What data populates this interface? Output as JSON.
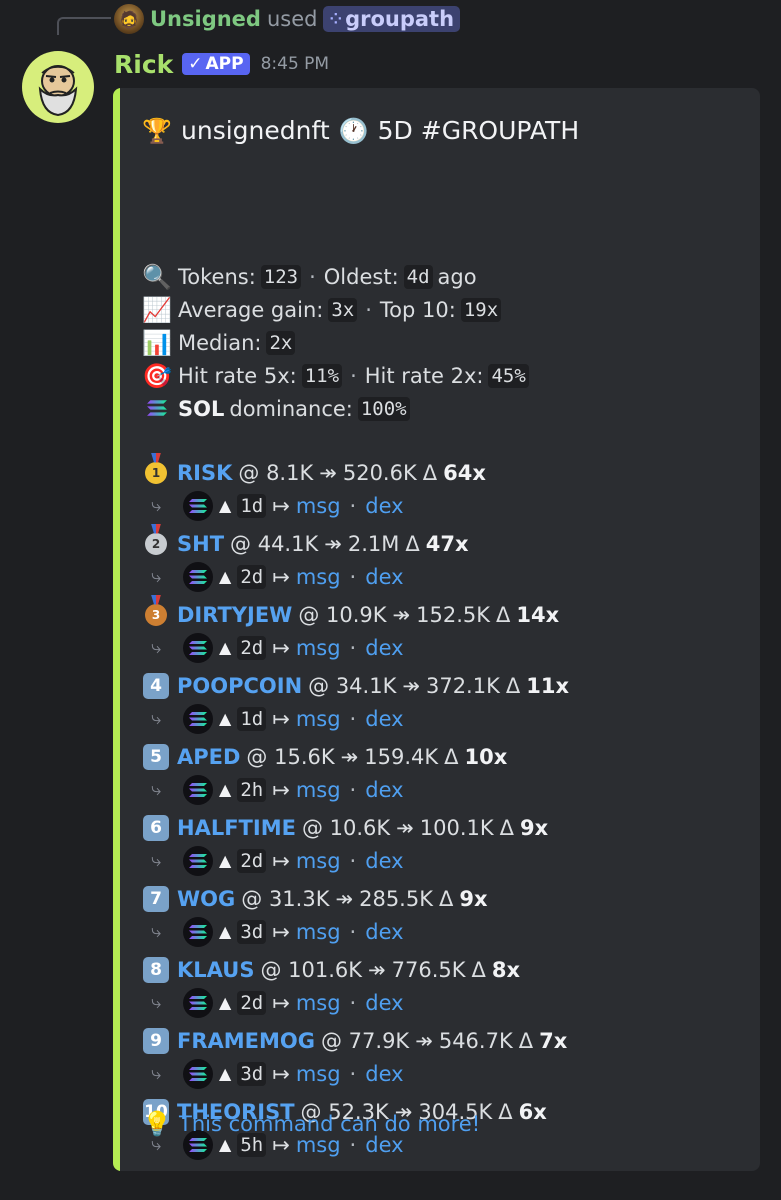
{
  "reply": {
    "username": "Unsigned",
    "used_text": "used",
    "command": "groupath"
  },
  "author": {
    "name": "Rick",
    "badge": "APP",
    "timestamp": "8:45 PM"
  },
  "embed": {
    "accent_color": "#b5ec53",
    "title_user": "unsignednft",
    "title_period": "5D #GROUPATH",
    "stats": {
      "tokens_label": "Tokens:",
      "tokens_value": "123",
      "oldest_label": "Oldest:",
      "oldest_value": "4d",
      "oldest_suffix": "ago",
      "avg_label": "Average gain:",
      "avg_value": "3x",
      "top10_label": "Top 10:",
      "top10_value": "19x",
      "median_label": "Median:",
      "median_value": "2x",
      "hit5_label": "Hit rate 5x:",
      "hit5_value": "11%",
      "hit2_label": "Hit rate 2x:",
      "hit2_value": "45%",
      "sol_label": "SOL",
      "dominance_label": "dominance:",
      "dominance_value": "100%"
    },
    "tokens": [
      {
        "rank": "1",
        "name": "RISK",
        "entry": "@ 8.1K",
        "peak": "520.6K",
        "mult": "64x",
        "age": "1d"
      },
      {
        "rank": "2",
        "name": "SHT",
        "entry": "@ 44.1K",
        "peak": "2.1M",
        "mult": "47x",
        "age": "2d"
      },
      {
        "rank": "3",
        "name": "DIRTYJEW",
        "entry": "@ 10.9K",
        "peak": "152.5K",
        "mult": "14x",
        "age": "2d"
      },
      {
        "rank": "4",
        "name": "POOPCOIN",
        "entry": "@ 34.1K",
        "peak": "372.1K",
        "mult": "11x",
        "age": "1d"
      },
      {
        "rank": "5",
        "name": "APED",
        "entry": "@ 15.6K",
        "peak": "159.4K",
        "mult": "10x",
        "age": "2h"
      },
      {
        "rank": "6",
        "name": "HALFTIME",
        "entry": "@ 10.6K",
        "peak": "100.1K",
        "mult": "9x",
        "age": "2d"
      },
      {
        "rank": "7",
        "name": "WOG",
        "entry": "@ 31.3K",
        "peak": "285.5K",
        "mult": "9x",
        "age": "3d"
      },
      {
        "rank": "8",
        "name": "KLAUS",
        "entry": "@ 101.6K",
        "peak": "776.5K",
        "mult": "8x",
        "age": "2d"
      },
      {
        "rank": "9",
        "name": "FRAMEMOG",
        "entry": "@ 77.9K",
        "peak": "546.7K",
        "mult": "7x",
        "age": "3d"
      },
      {
        "rank": "10",
        "name": "THEORIST",
        "entry": "@ 52.3K",
        "peak": "304.5K",
        "mult": "6x",
        "age": "5h"
      }
    ],
    "link_msg": "msg",
    "link_dex": "dex",
    "footer": "This command can do more!"
  }
}
